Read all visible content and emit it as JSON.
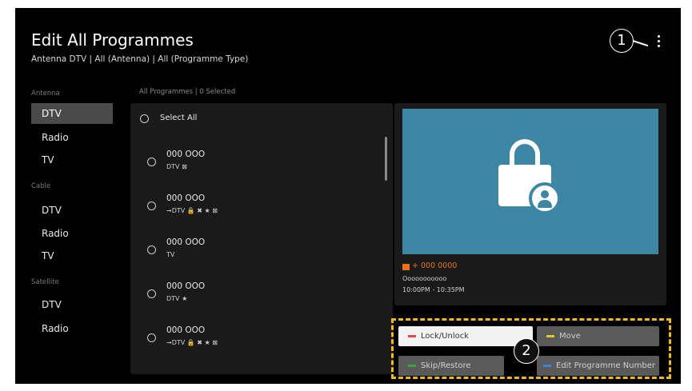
{
  "header": {
    "title": "Edit All Programmes",
    "subtitle": "Antenna DTV | All (Antenna) | All (Programme Type)"
  },
  "callouts": {
    "one": "1",
    "two": "2"
  },
  "sidebar": {
    "sections": [
      {
        "label": "Antenna",
        "items": [
          {
            "label": "DTV",
            "selected": true
          },
          {
            "label": "Radio"
          },
          {
            "label": "TV"
          }
        ]
      },
      {
        "label": "Cable",
        "items": [
          {
            "label": "DTV"
          },
          {
            "label": "Radio"
          },
          {
            "label": "TV"
          }
        ]
      },
      {
        "label": "Satellite",
        "items": [
          {
            "label": "DTV"
          },
          {
            "label": "Radio"
          }
        ]
      }
    ]
  },
  "list": {
    "header": "All Programmes | 0 Selected",
    "select_all": "Select All",
    "programmes": [
      {
        "name": "000 OOO",
        "sub": "DTV ⊠"
      },
      {
        "name": "000 OOO",
        "sub": "➞DTV 🔒 ✖ ★ ⊠"
      },
      {
        "name": "000 OOO",
        "sub": "TV"
      },
      {
        "name": "000 OOO",
        "sub": "DTV ★"
      },
      {
        "name": "000 OOO",
        "sub": "➞DTV 🔒 ✖ ★ ⊠"
      }
    ]
  },
  "preview": {
    "icon": "lock-person-icon",
    "channel": "+ 000 0000",
    "description": "Ooooooooooo",
    "time": "10:00PM - 10:35PM"
  },
  "actions": {
    "lock_unlock": "Lock/Unlock",
    "move": "Move",
    "skip_restore": "Skip/Restore",
    "edit_number": "Edit Programme Number"
  },
  "colors": {
    "accent_dashed": "#f2b91c",
    "red_key": "#e8464b",
    "yellow_key": "#e7c233",
    "green_key": "#3aa63a",
    "blue_key": "#3a86d6",
    "preview_bg": "#3d86a4",
    "channel_orange": "#e8731f"
  }
}
